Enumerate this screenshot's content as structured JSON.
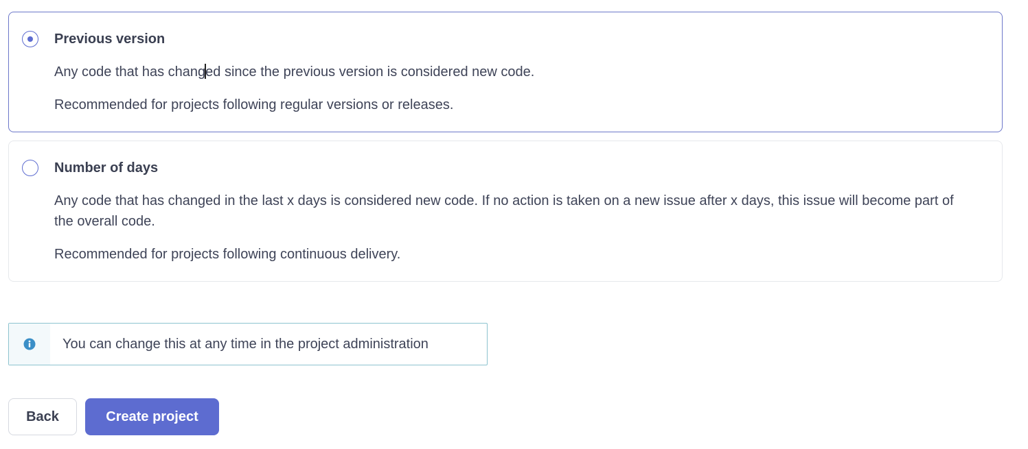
{
  "options": [
    {
      "title": "Previous version",
      "selected": true,
      "description_before_caret": "Any code that has chang",
      "description_after_caret": "ed since the previous version is considered new code.",
      "recommendation": "Recommended for projects following regular versions or releases."
    },
    {
      "title": "Number of days",
      "selected": false,
      "description": "Any code that has changed in the last x days is considered new code. If no action is taken on a new issue after x days, this issue will become part of the overall code.",
      "recommendation": "Recommended for projects following continuous delivery."
    }
  ],
  "info": {
    "icon": "info-icon",
    "text": "You can change this at any time in the project administration"
  },
  "actions": {
    "back_label": "Back",
    "create_label": "Create project"
  },
  "colors": {
    "accent": "#5d6cd0",
    "selected_border": "#6b76c9",
    "info_border": "#8cc3cf",
    "info_icon": "#3b8fc7"
  }
}
